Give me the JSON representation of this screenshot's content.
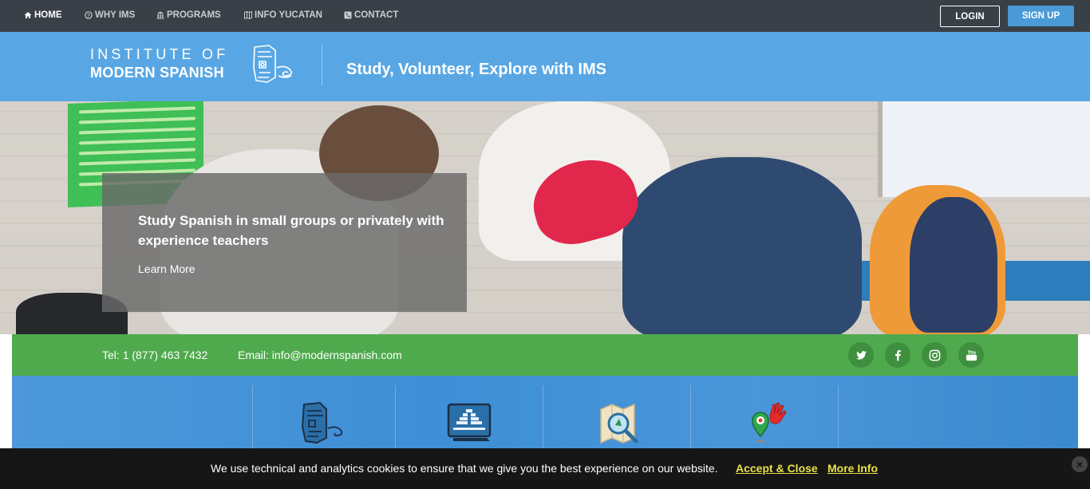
{
  "topnav": {
    "items": [
      {
        "label": "HOME",
        "icon": "home-icon",
        "active": true
      },
      {
        "label": "WHY IMS",
        "icon": "question-circle-icon",
        "active": false
      },
      {
        "label": "PROGRAMS",
        "icon": "institution-icon",
        "active": false
      },
      {
        "label": "INFO YUCATAN",
        "icon": "map-icon",
        "active": false
      },
      {
        "label": "CONTACT",
        "icon": "phone-square-icon",
        "active": false
      }
    ],
    "login_label": "LOGIN",
    "signup_label": "SIGN UP"
  },
  "header": {
    "logo_line1": "INSTITUTE OF",
    "logo_line2": "MODERN SPANISH",
    "tagline": "Study, Volunteer, Explore with IMS"
  },
  "hero": {
    "title": "Study Spanish in small groups or privately with experience teachers",
    "link_label": "Learn More"
  },
  "contact": {
    "tel_label": "Tel:",
    "tel_value": "1 (877) 463 7432",
    "email_label": "Email:",
    "email_value": "info@modernspanish.com",
    "social": [
      "twitter-icon",
      "facebook-icon",
      "instagram-icon",
      "youtube-icon"
    ]
  },
  "features": {
    "icons": [
      "mayan-head-icon",
      "pyramid-screen-icon",
      "map-magnifier-icon",
      "location-pin-hand-icon"
    ]
  },
  "cookie": {
    "text": "We use technical and analytics cookies to ensure that we give you the best experience on our website.",
    "accept_label": "Accept & Close",
    "more_label": "More Info",
    "close_label": "×"
  },
  "colors": {
    "nav_bg": "#3a4048",
    "header_bg": "#58a7e4",
    "signup_bg": "#4a9ad8",
    "contact_bg": "#4faa4d",
    "features_bg": "#3e8fd6",
    "cookie_bg": "#161616",
    "cookie_link": "#e8e047"
  }
}
